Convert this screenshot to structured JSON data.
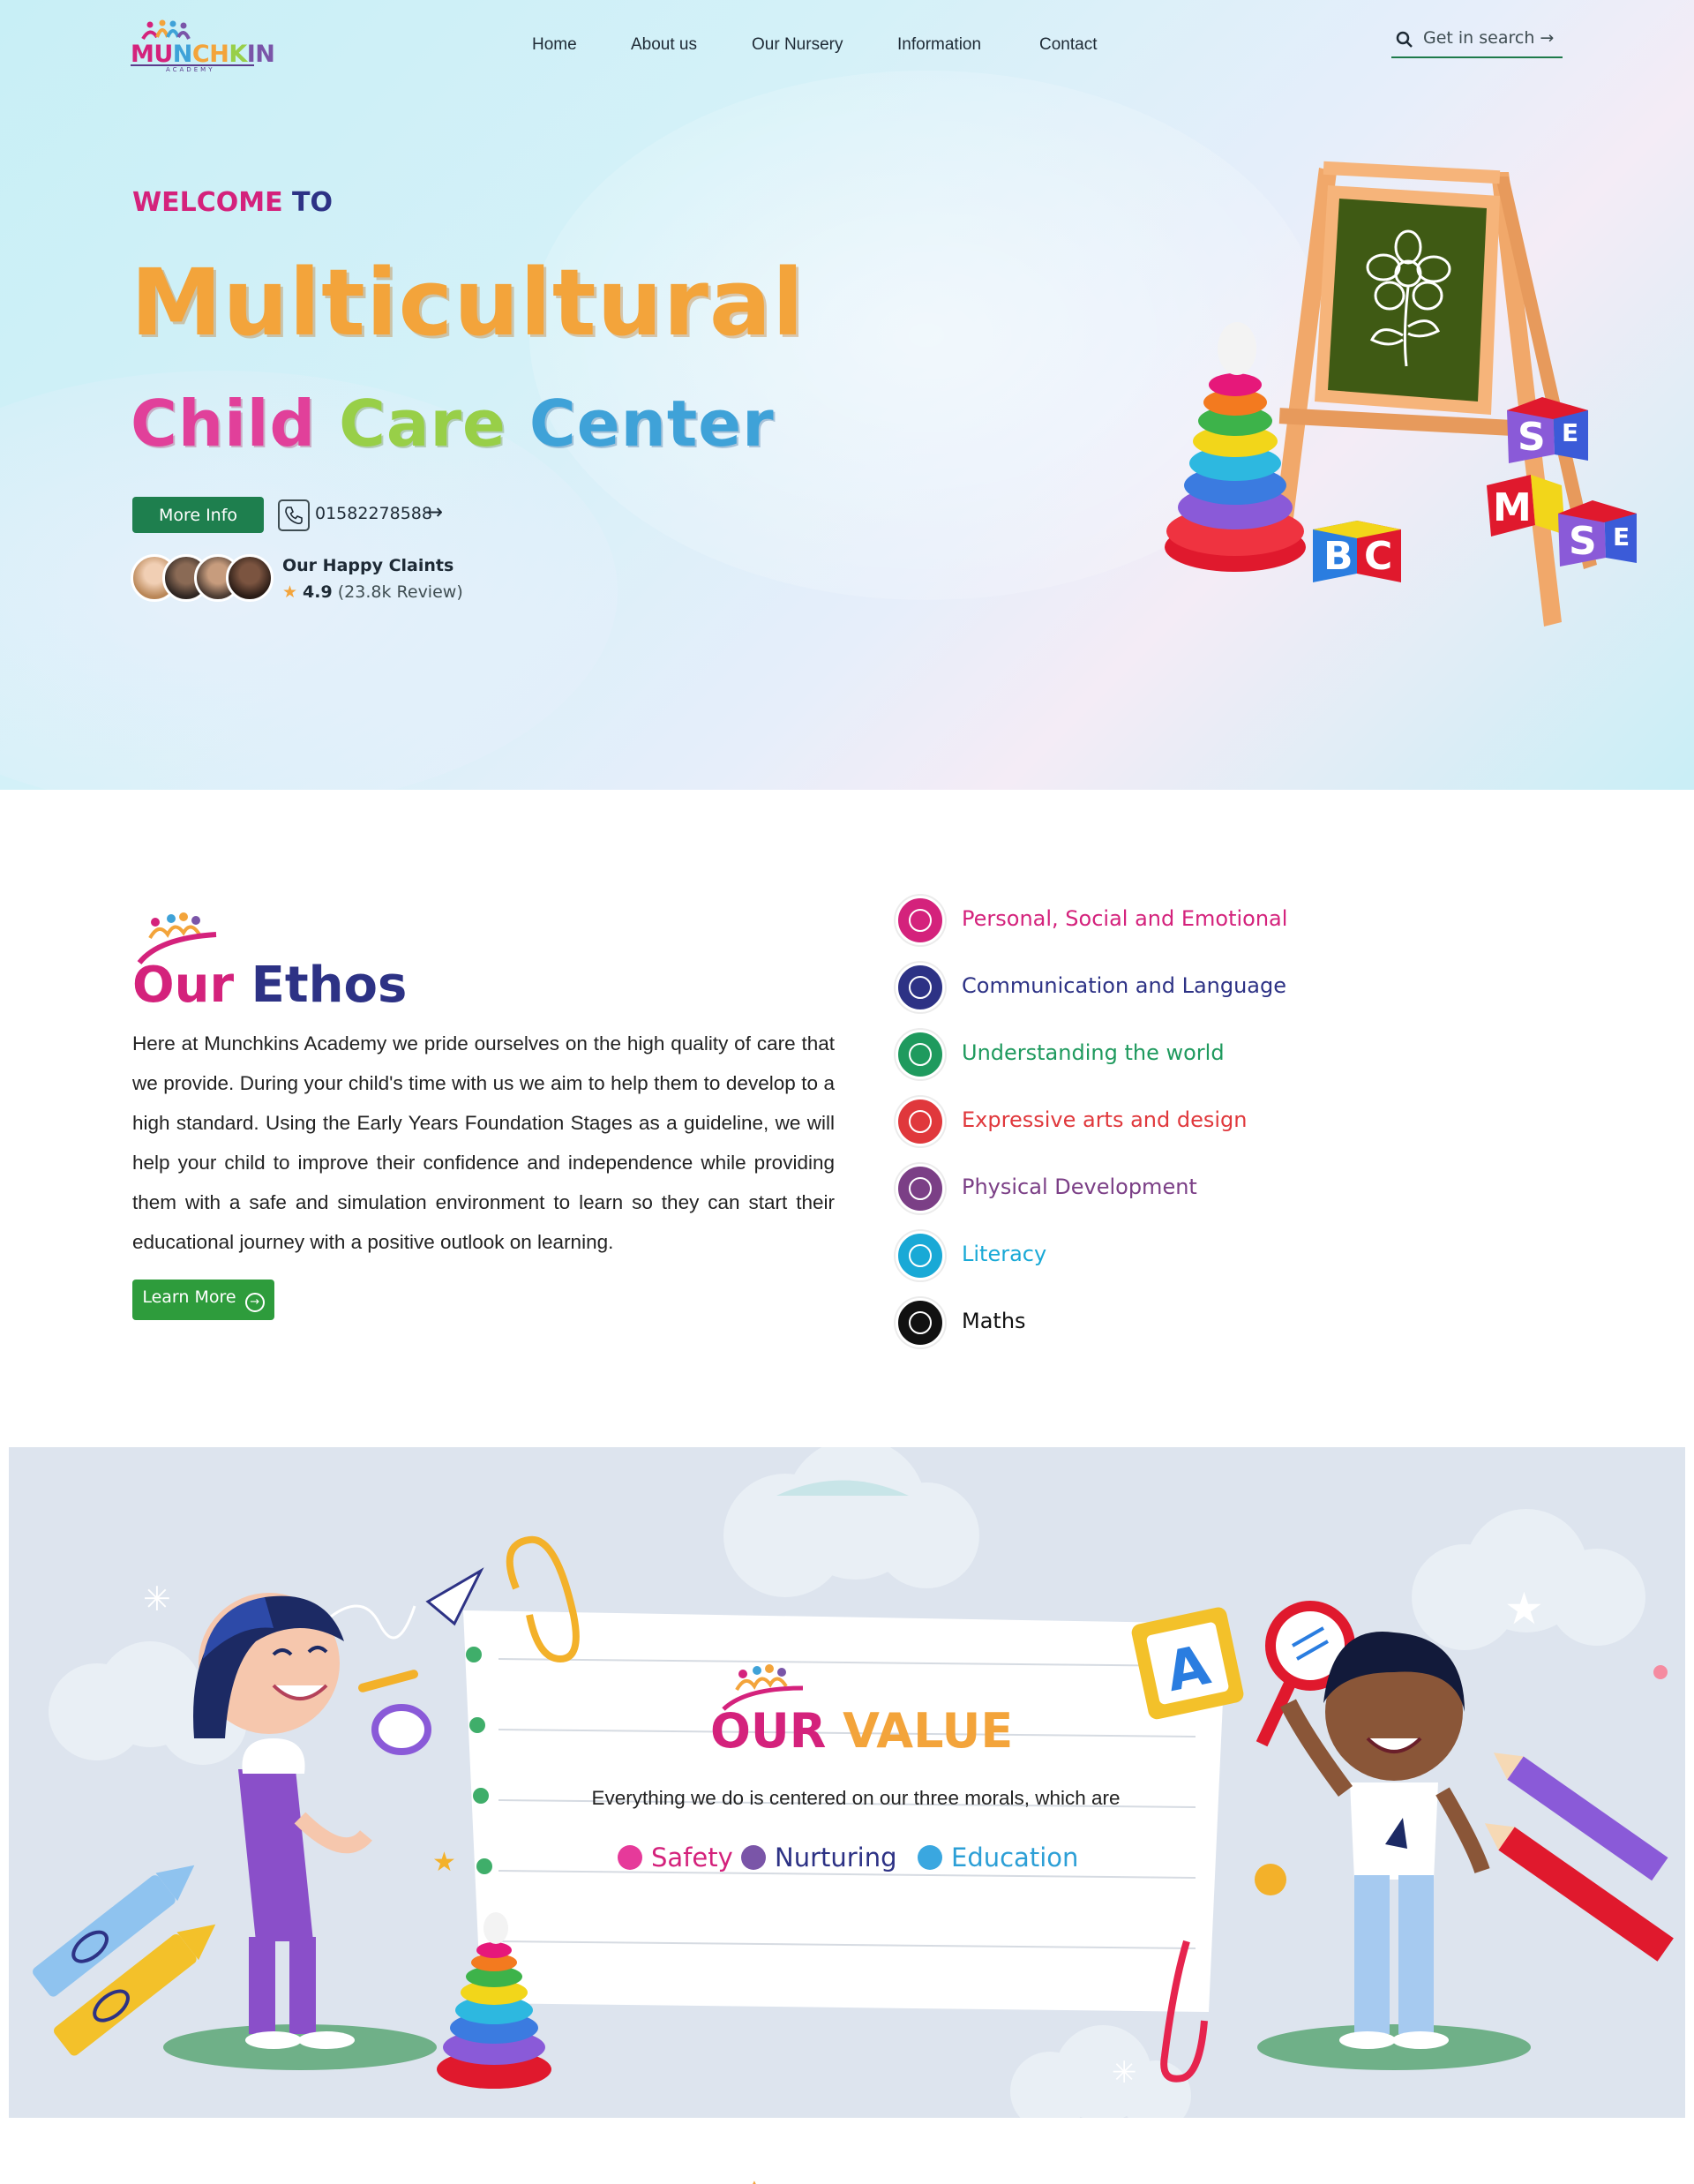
{
  "brand": {
    "logo_text": "MUNCHKIN",
    "logo_sub": "ACADEMY",
    "colors": {
      "pink": "#d4227c",
      "navy": "#2d3285",
      "orange": "#f3a43b",
      "green": "#1e7f4e",
      "light_green": "#98cf48",
      "blue": "#3fa2d8"
    }
  },
  "nav": {
    "items": [
      {
        "label": "Home"
      },
      {
        "label": "About us"
      },
      {
        "label": "Our Nursery"
      },
      {
        "label": "Information"
      },
      {
        "label": "Contact"
      }
    ],
    "search_label": "Get in search →",
    "search_icon": "search-icon"
  },
  "hero": {
    "welcome_a": "WELCOME",
    "welcome_b": "TO",
    "headline": "Multicultural",
    "sub_a": "Child",
    "sub_b": "Care",
    "sub_c": "Center",
    "more_info_label": "More Info",
    "phone_icon": "phone-icon",
    "phone": "01582278588",
    "phone_arrow": "→",
    "happy_title": "Our Happy Claints",
    "rating": "4.9",
    "reviews": "(23.8k Review)",
    "art_icon": "toys-illustration"
  },
  "ethos": {
    "title_a": "Our",
    "title_b": "Ethos",
    "text": "Here at Munchkins Academy we pride ourselves on the high quality of care that we provide. During your child's time with us we aim to help them to develop to a high standard. Using the Early Years Foundation Stages as a guideline, we will help your child to improve their confidence and independence while providing them with a safe and simulation environment to learn so they can start their educational journey with a positive outlook on learning.",
    "learn_more_label": "Learn More",
    "areas": [
      {
        "label": "Personal, Social and Emotional",
        "color": "#d4227c",
        "icon": "brain-heart-icon"
      },
      {
        "label": "Communication and Language",
        "color": "#2d3285",
        "icon": "speech-icon"
      },
      {
        "label": "Understanding the world",
        "color": "#1f9a5e",
        "icon": "head-globe-icon"
      },
      {
        "label": "Expressive arts and design",
        "color": "#e0383c",
        "icon": "palette-icon"
      },
      {
        "label": "Physical Development",
        "color": "#7b3f86",
        "icon": "head-gears-icon"
      },
      {
        "label": "Literacy",
        "color": "#19a9d6",
        "icon": "book-icon"
      },
      {
        "label": "Maths",
        "color": "#111111",
        "icon": "head-numbers-icon"
      }
    ]
  },
  "value": {
    "title_a": "OUR",
    "title_b": "VALUE",
    "subtitle": "Everything we do is centered on our three morals, which are",
    "morals": [
      {
        "label": "Safety",
        "color": "#d4227c",
        "dot": "#e63a9a"
      },
      {
        "label": "Nurturing",
        "color": "#2d3285",
        "dot": "#7a55a8"
      },
      {
        "label": "Education",
        "color": "#2c9fd6",
        "dot": "#3aa7e0"
      }
    ]
  }
}
